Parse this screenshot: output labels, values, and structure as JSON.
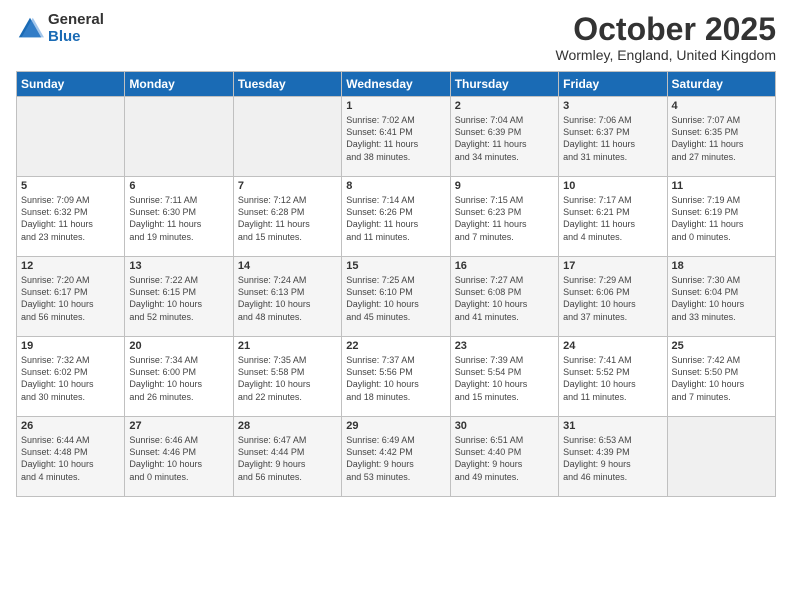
{
  "logo": {
    "general": "General",
    "blue": "Blue"
  },
  "title": "October 2025",
  "subtitle": "Wormley, England, United Kingdom",
  "days_of_week": [
    "Sunday",
    "Monday",
    "Tuesday",
    "Wednesday",
    "Thursday",
    "Friday",
    "Saturday"
  ],
  "weeks": [
    [
      {
        "day": "",
        "info": ""
      },
      {
        "day": "",
        "info": ""
      },
      {
        "day": "",
        "info": ""
      },
      {
        "day": "1",
        "info": "Sunrise: 7:02 AM\nSunset: 6:41 PM\nDaylight: 11 hours\nand 38 minutes."
      },
      {
        "day": "2",
        "info": "Sunrise: 7:04 AM\nSunset: 6:39 PM\nDaylight: 11 hours\nand 34 minutes."
      },
      {
        "day": "3",
        "info": "Sunrise: 7:06 AM\nSunset: 6:37 PM\nDaylight: 11 hours\nand 31 minutes."
      },
      {
        "day": "4",
        "info": "Sunrise: 7:07 AM\nSunset: 6:35 PM\nDaylight: 11 hours\nand 27 minutes."
      }
    ],
    [
      {
        "day": "5",
        "info": "Sunrise: 7:09 AM\nSunset: 6:32 PM\nDaylight: 11 hours\nand 23 minutes."
      },
      {
        "day": "6",
        "info": "Sunrise: 7:11 AM\nSunset: 6:30 PM\nDaylight: 11 hours\nand 19 minutes."
      },
      {
        "day": "7",
        "info": "Sunrise: 7:12 AM\nSunset: 6:28 PM\nDaylight: 11 hours\nand 15 minutes."
      },
      {
        "day": "8",
        "info": "Sunrise: 7:14 AM\nSunset: 6:26 PM\nDaylight: 11 hours\nand 11 minutes."
      },
      {
        "day": "9",
        "info": "Sunrise: 7:15 AM\nSunset: 6:23 PM\nDaylight: 11 hours\nand 7 minutes."
      },
      {
        "day": "10",
        "info": "Sunrise: 7:17 AM\nSunset: 6:21 PM\nDaylight: 11 hours\nand 4 minutes."
      },
      {
        "day": "11",
        "info": "Sunrise: 7:19 AM\nSunset: 6:19 PM\nDaylight: 11 hours\nand 0 minutes."
      }
    ],
    [
      {
        "day": "12",
        "info": "Sunrise: 7:20 AM\nSunset: 6:17 PM\nDaylight: 10 hours\nand 56 minutes."
      },
      {
        "day": "13",
        "info": "Sunrise: 7:22 AM\nSunset: 6:15 PM\nDaylight: 10 hours\nand 52 minutes."
      },
      {
        "day": "14",
        "info": "Sunrise: 7:24 AM\nSunset: 6:13 PM\nDaylight: 10 hours\nand 48 minutes."
      },
      {
        "day": "15",
        "info": "Sunrise: 7:25 AM\nSunset: 6:10 PM\nDaylight: 10 hours\nand 45 minutes."
      },
      {
        "day": "16",
        "info": "Sunrise: 7:27 AM\nSunset: 6:08 PM\nDaylight: 10 hours\nand 41 minutes."
      },
      {
        "day": "17",
        "info": "Sunrise: 7:29 AM\nSunset: 6:06 PM\nDaylight: 10 hours\nand 37 minutes."
      },
      {
        "day": "18",
        "info": "Sunrise: 7:30 AM\nSunset: 6:04 PM\nDaylight: 10 hours\nand 33 minutes."
      }
    ],
    [
      {
        "day": "19",
        "info": "Sunrise: 7:32 AM\nSunset: 6:02 PM\nDaylight: 10 hours\nand 30 minutes."
      },
      {
        "day": "20",
        "info": "Sunrise: 7:34 AM\nSunset: 6:00 PM\nDaylight: 10 hours\nand 26 minutes."
      },
      {
        "day": "21",
        "info": "Sunrise: 7:35 AM\nSunset: 5:58 PM\nDaylight: 10 hours\nand 22 minutes."
      },
      {
        "day": "22",
        "info": "Sunrise: 7:37 AM\nSunset: 5:56 PM\nDaylight: 10 hours\nand 18 minutes."
      },
      {
        "day": "23",
        "info": "Sunrise: 7:39 AM\nSunset: 5:54 PM\nDaylight: 10 hours\nand 15 minutes."
      },
      {
        "day": "24",
        "info": "Sunrise: 7:41 AM\nSunset: 5:52 PM\nDaylight: 10 hours\nand 11 minutes."
      },
      {
        "day": "25",
        "info": "Sunrise: 7:42 AM\nSunset: 5:50 PM\nDaylight: 10 hours\nand 7 minutes."
      }
    ],
    [
      {
        "day": "26",
        "info": "Sunrise: 6:44 AM\nSunset: 4:48 PM\nDaylight: 10 hours\nand 4 minutes."
      },
      {
        "day": "27",
        "info": "Sunrise: 6:46 AM\nSunset: 4:46 PM\nDaylight: 10 hours\nand 0 minutes."
      },
      {
        "day": "28",
        "info": "Sunrise: 6:47 AM\nSunset: 4:44 PM\nDaylight: 9 hours\nand 56 minutes."
      },
      {
        "day": "29",
        "info": "Sunrise: 6:49 AM\nSunset: 4:42 PM\nDaylight: 9 hours\nand 53 minutes."
      },
      {
        "day": "30",
        "info": "Sunrise: 6:51 AM\nSunset: 4:40 PM\nDaylight: 9 hours\nand 49 minutes."
      },
      {
        "day": "31",
        "info": "Sunrise: 6:53 AM\nSunset: 4:39 PM\nDaylight: 9 hours\nand 46 minutes."
      },
      {
        "day": "",
        "info": ""
      }
    ]
  ]
}
